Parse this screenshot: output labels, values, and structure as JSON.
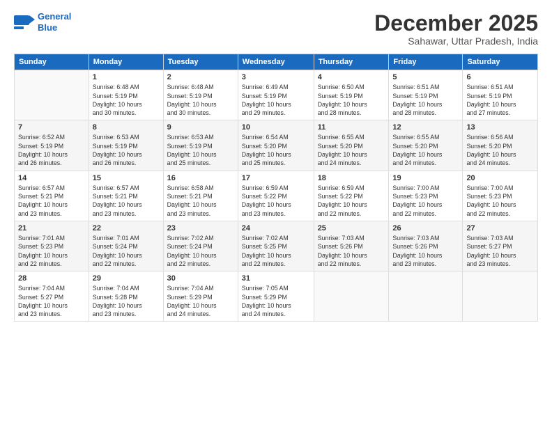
{
  "logo": {
    "line1": "General",
    "line2": "Blue"
  },
  "header": {
    "month": "December 2025",
    "location": "Sahawar, Uttar Pradesh, India"
  },
  "weekdays": [
    "Sunday",
    "Monday",
    "Tuesday",
    "Wednesday",
    "Thursday",
    "Friday",
    "Saturday"
  ],
  "weeks": [
    [
      {
        "day": "",
        "info": ""
      },
      {
        "day": "1",
        "info": "Sunrise: 6:48 AM\nSunset: 5:19 PM\nDaylight: 10 hours\nand 30 minutes."
      },
      {
        "day": "2",
        "info": "Sunrise: 6:48 AM\nSunset: 5:19 PM\nDaylight: 10 hours\nand 30 minutes."
      },
      {
        "day": "3",
        "info": "Sunrise: 6:49 AM\nSunset: 5:19 PM\nDaylight: 10 hours\nand 29 minutes."
      },
      {
        "day": "4",
        "info": "Sunrise: 6:50 AM\nSunset: 5:19 PM\nDaylight: 10 hours\nand 28 minutes."
      },
      {
        "day": "5",
        "info": "Sunrise: 6:51 AM\nSunset: 5:19 PM\nDaylight: 10 hours\nand 28 minutes."
      },
      {
        "day": "6",
        "info": "Sunrise: 6:51 AM\nSunset: 5:19 PM\nDaylight: 10 hours\nand 27 minutes."
      }
    ],
    [
      {
        "day": "7",
        "info": "Sunrise: 6:52 AM\nSunset: 5:19 PM\nDaylight: 10 hours\nand 26 minutes."
      },
      {
        "day": "8",
        "info": "Sunrise: 6:53 AM\nSunset: 5:19 PM\nDaylight: 10 hours\nand 26 minutes."
      },
      {
        "day": "9",
        "info": "Sunrise: 6:53 AM\nSunset: 5:19 PM\nDaylight: 10 hours\nand 25 minutes."
      },
      {
        "day": "10",
        "info": "Sunrise: 6:54 AM\nSunset: 5:20 PM\nDaylight: 10 hours\nand 25 minutes."
      },
      {
        "day": "11",
        "info": "Sunrise: 6:55 AM\nSunset: 5:20 PM\nDaylight: 10 hours\nand 24 minutes."
      },
      {
        "day": "12",
        "info": "Sunrise: 6:55 AM\nSunset: 5:20 PM\nDaylight: 10 hours\nand 24 minutes."
      },
      {
        "day": "13",
        "info": "Sunrise: 6:56 AM\nSunset: 5:20 PM\nDaylight: 10 hours\nand 24 minutes."
      }
    ],
    [
      {
        "day": "14",
        "info": "Sunrise: 6:57 AM\nSunset: 5:21 PM\nDaylight: 10 hours\nand 23 minutes."
      },
      {
        "day": "15",
        "info": "Sunrise: 6:57 AM\nSunset: 5:21 PM\nDaylight: 10 hours\nand 23 minutes."
      },
      {
        "day": "16",
        "info": "Sunrise: 6:58 AM\nSunset: 5:21 PM\nDaylight: 10 hours\nand 23 minutes."
      },
      {
        "day": "17",
        "info": "Sunrise: 6:59 AM\nSunset: 5:22 PM\nDaylight: 10 hours\nand 23 minutes."
      },
      {
        "day": "18",
        "info": "Sunrise: 6:59 AM\nSunset: 5:22 PM\nDaylight: 10 hours\nand 22 minutes."
      },
      {
        "day": "19",
        "info": "Sunrise: 7:00 AM\nSunset: 5:23 PM\nDaylight: 10 hours\nand 22 minutes."
      },
      {
        "day": "20",
        "info": "Sunrise: 7:00 AM\nSunset: 5:23 PM\nDaylight: 10 hours\nand 22 minutes."
      }
    ],
    [
      {
        "day": "21",
        "info": "Sunrise: 7:01 AM\nSunset: 5:23 PM\nDaylight: 10 hours\nand 22 minutes."
      },
      {
        "day": "22",
        "info": "Sunrise: 7:01 AM\nSunset: 5:24 PM\nDaylight: 10 hours\nand 22 minutes."
      },
      {
        "day": "23",
        "info": "Sunrise: 7:02 AM\nSunset: 5:24 PM\nDaylight: 10 hours\nand 22 minutes."
      },
      {
        "day": "24",
        "info": "Sunrise: 7:02 AM\nSunset: 5:25 PM\nDaylight: 10 hours\nand 22 minutes."
      },
      {
        "day": "25",
        "info": "Sunrise: 7:03 AM\nSunset: 5:26 PM\nDaylight: 10 hours\nand 22 minutes."
      },
      {
        "day": "26",
        "info": "Sunrise: 7:03 AM\nSunset: 5:26 PM\nDaylight: 10 hours\nand 23 minutes."
      },
      {
        "day": "27",
        "info": "Sunrise: 7:03 AM\nSunset: 5:27 PM\nDaylight: 10 hours\nand 23 minutes."
      }
    ],
    [
      {
        "day": "28",
        "info": "Sunrise: 7:04 AM\nSunset: 5:27 PM\nDaylight: 10 hours\nand 23 minutes."
      },
      {
        "day": "29",
        "info": "Sunrise: 7:04 AM\nSunset: 5:28 PM\nDaylight: 10 hours\nand 23 minutes."
      },
      {
        "day": "30",
        "info": "Sunrise: 7:04 AM\nSunset: 5:29 PM\nDaylight: 10 hours\nand 24 minutes."
      },
      {
        "day": "31",
        "info": "Sunrise: 7:05 AM\nSunset: 5:29 PM\nDaylight: 10 hours\nand 24 minutes."
      },
      {
        "day": "",
        "info": ""
      },
      {
        "day": "",
        "info": ""
      },
      {
        "day": "",
        "info": ""
      }
    ]
  ]
}
